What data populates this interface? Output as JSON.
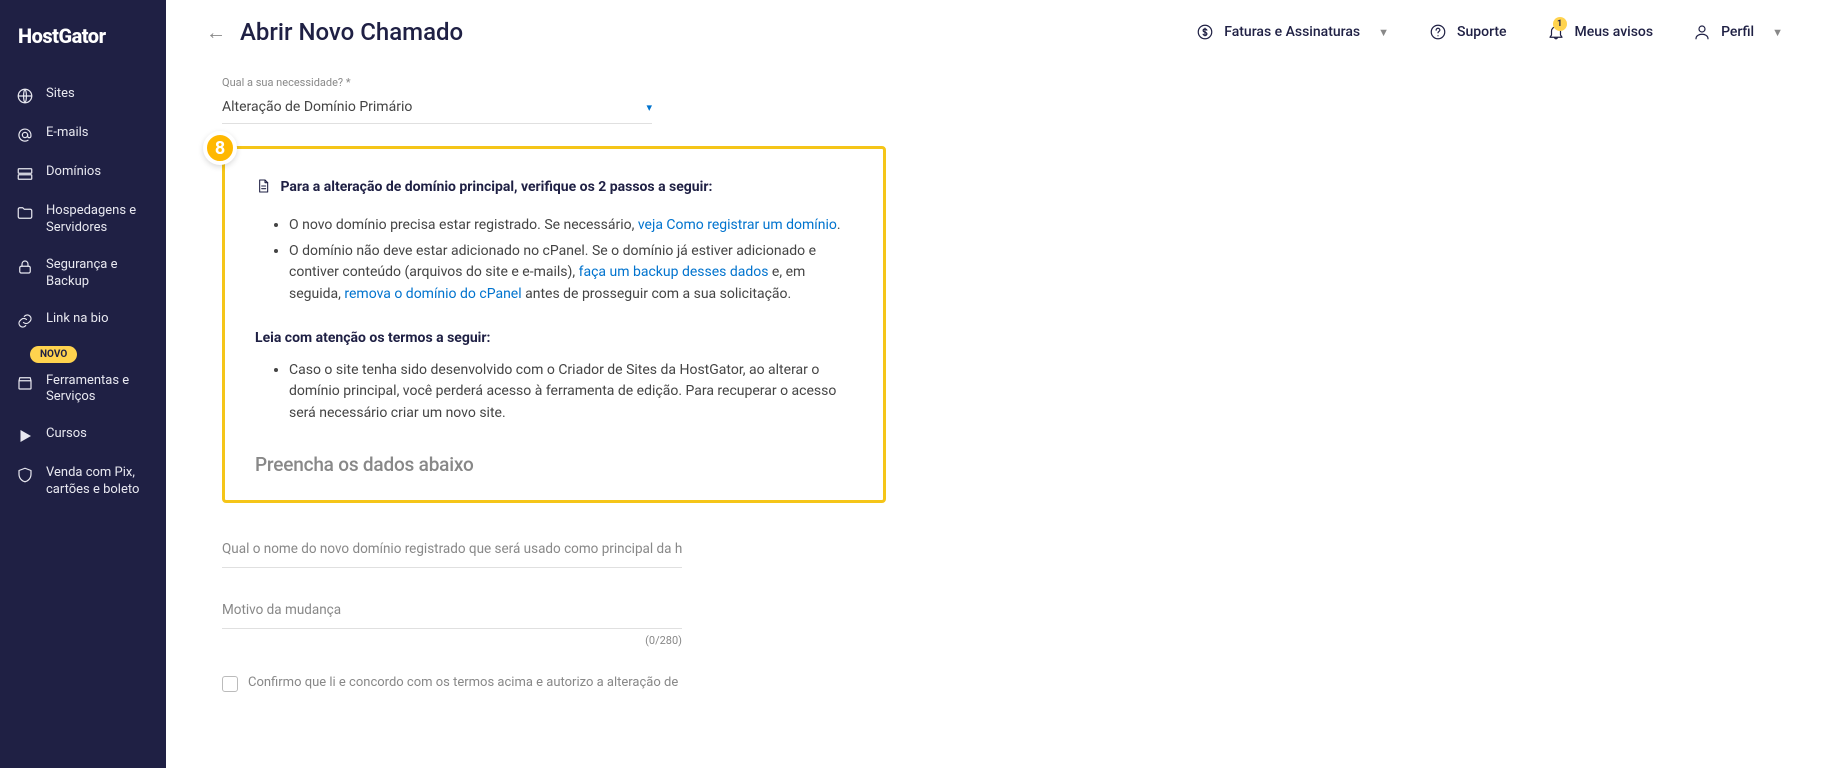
{
  "brand": "HostGator",
  "page_title": "Abrir Novo Chamado",
  "header": {
    "billing": "Faturas e Assinaturas",
    "support": "Suporte",
    "notices": "Meus avisos",
    "notice_count": "1",
    "profile": "Perfil"
  },
  "sidebar": {
    "sites": "Sites",
    "emails": "E-mails",
    "dominios": "Domínios",
    "hospedagens": "Hospedagens e Servidores",
    "seguranca": "Segurança e Backup",
    "linkbio": "Link na bio",
    "linkbio_badge": "NOVO",
    "ferramentas": "Ferramentas e Serviços",
    "cursos": "Cursos",
    "vendapix": "Venda com Pix, cartões e boleto"
  },
  "form": {
    "need_label": "Qual a sua necessidade? *",
    "need_value": "Alteração de Domínio Primário",
    "step_number": "8",
    "info_heading_pre": "Para a alteração de domínio principal, verifique os 2 passos a seguir:",
    "li1_text": "O novo domínio precisa estar registrado. Se necessário, ",
    "li1_link": "veja Como registrar um domínio",
    "li1_after": ".",
    "li2_text1": "O domínio não deve estar adicionado no cPanel. Se o domínio já estiver adicionado e contiver conteúdo (arquivos do site e e-mails), ",
    "li2_link1": "faça um backup desses dados",
    "li2_text2": " e, em seguida, ",
    "li2_link2": "remova o domínio do cPanel",
    "li2_text3": " antes de prosseguir com a sua solicitação.",
    "terms_heading": "Leia com atenção os termos a seguir:",
    "li3_text": "Caso o site tenha sido desenvolvido com o Criador de Sites da HostGator, ao alterar o domínio principal, você perderá acesso à ferramenta de edição. Para recuperar o acesso será necessário criar um novo site.",
    "fill_title": "Preencha os dados abaixo",
    "input_domain_placeholder": "Qual o nome do novo domínio registrado que será usado como principal da ho",
    "input_reason_placeholder": "Motivo da mudança",
    "char_count": "(0/280)",
    "checkbox_text": "Confirmo que li e concordo com os termos acima e autorizo a alteração de"
  }
}
